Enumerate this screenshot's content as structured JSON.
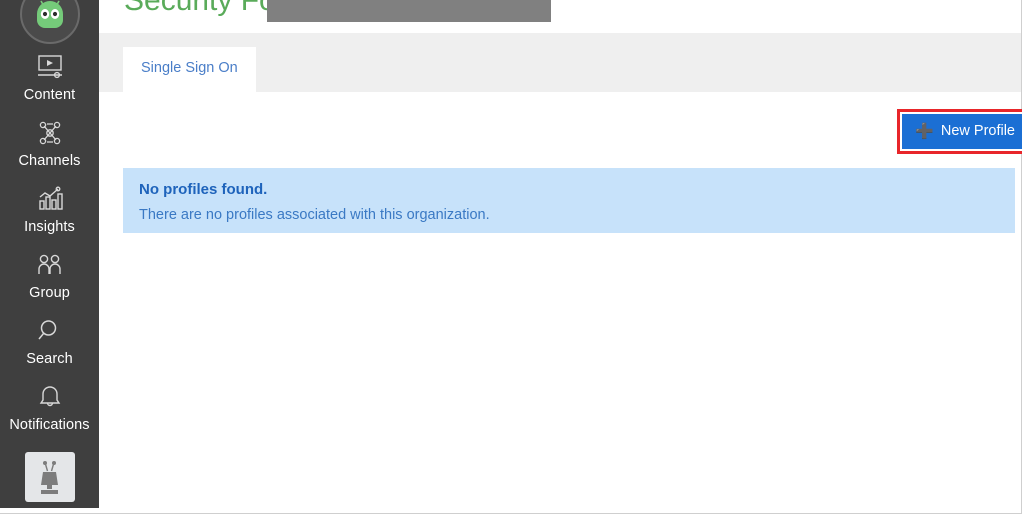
{
  "sidebar": {
    "logo": {
      "icon": "android-robot-logo-icon"
    },
    "items": [
      {
        "label": "Content",
        "icon": "video-player-icon"
      },
      {
        "label": "Channels",
        "icon": "network-nodes-icon"
      },
      {
        "label": "Insights",
        "icon": "bar-chart-trend-icon"
      },
      {
        "label": "Group",
        "icon": "people-group-icon"
      },
      {
        "label": "Search",
        "icon": "magnifier-icon"
      },
      {
        "label": "Notifications",
        "icon": "bell-icon"
      }
    ],
    "avatar": {
      "icon": "robot-avatar-icon"
    }
  },
  "header": {
    "title": "Security For:",
    "title_color": "#5aab5a",
    "redacted_value": "",
    "redaction_color": "#808080"
  },
  "tabs": [
    {
      "label": "Single Sign On",
      "active": true
    }
  ],
  "toolbar": {
    "new_profile_label": "New Profile",
    "new_profile_icon": "plus-icon",
    "new_profile_color": "#1b6fd4",
    "highlight_color": "#e8262a"
  },
  "alert": {
    "title": "No profiles found.",
    "message": "There are no profiles associated with this organization.",
    "background_color": "#c7e2fa",
    "title_color": "#1e63bb",
    "text_color": "#3a79c4"
  }
}
